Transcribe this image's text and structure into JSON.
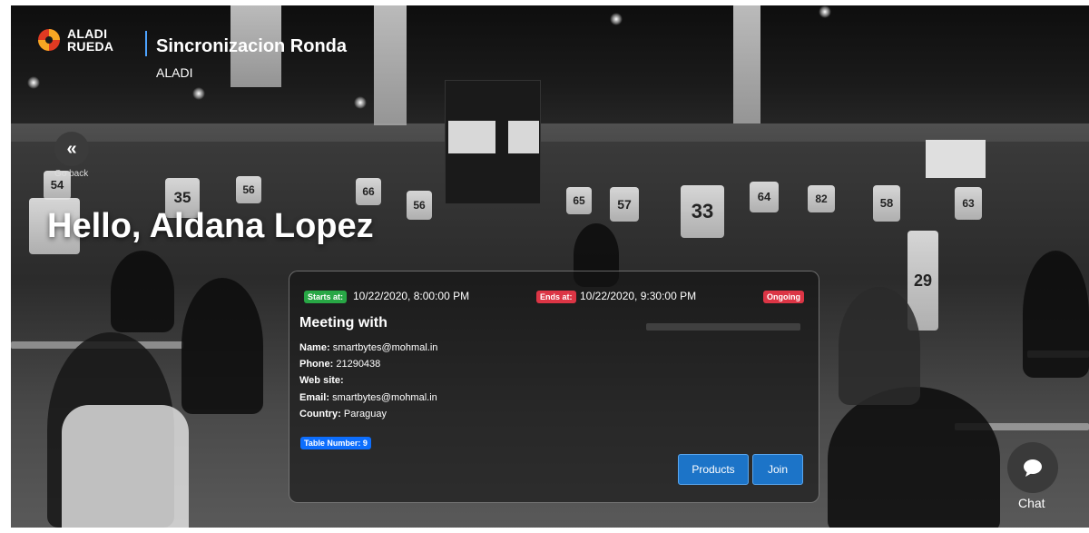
{
  "header": {
    "logo_line1": "ALADI",
    "logo_line2": "RUEDA",
    "title": "Sincronizacion Ronda",
    "subtitle": "ALADI"
  },
  "nav": {
    "back_icon": "double-chevron-left-icon",
    "back_label": "Go back"
  },
  "greeting": "Hello, Aldana Lopez",
  "meeting": {
    "starts_label": "Starts at:",
    "starts_value": "10/22/2020, 8:00:00 PM",
    "ends_label": "Ends at:",
    "ends_value": "10/22/2020, 9:30:00 PM",
    "status": "Ongoing",
    "heading": "Meeting with",
    "name_label": "Name:",
    "name_value": "smartbytes@mohmal.in",
    "phone_label": "Phone:",
    "phone_value": "21290438",
    "website_label": "Web site:",
    "website_value": "",
    "email_label": "Email:",
    "email_value": "smartbytes@mohmal.in",
    "country_label": "Country:",
    "country_value": "Paraguay",
    "table_badge": "Table Number: 9",
    "products_button": "Products",
    "join_button": "Join"
  },
  "chat": {
    "icon": "chat-bubble-icon",
    "label": "Chat"
  },
  "colors": {
    "accent_blue": "#1c74c8",
    "start_green": "#28a745",
    "end_red": "#dc3545",
    "table_badge_blue": "#0d6efd"
  }
}
